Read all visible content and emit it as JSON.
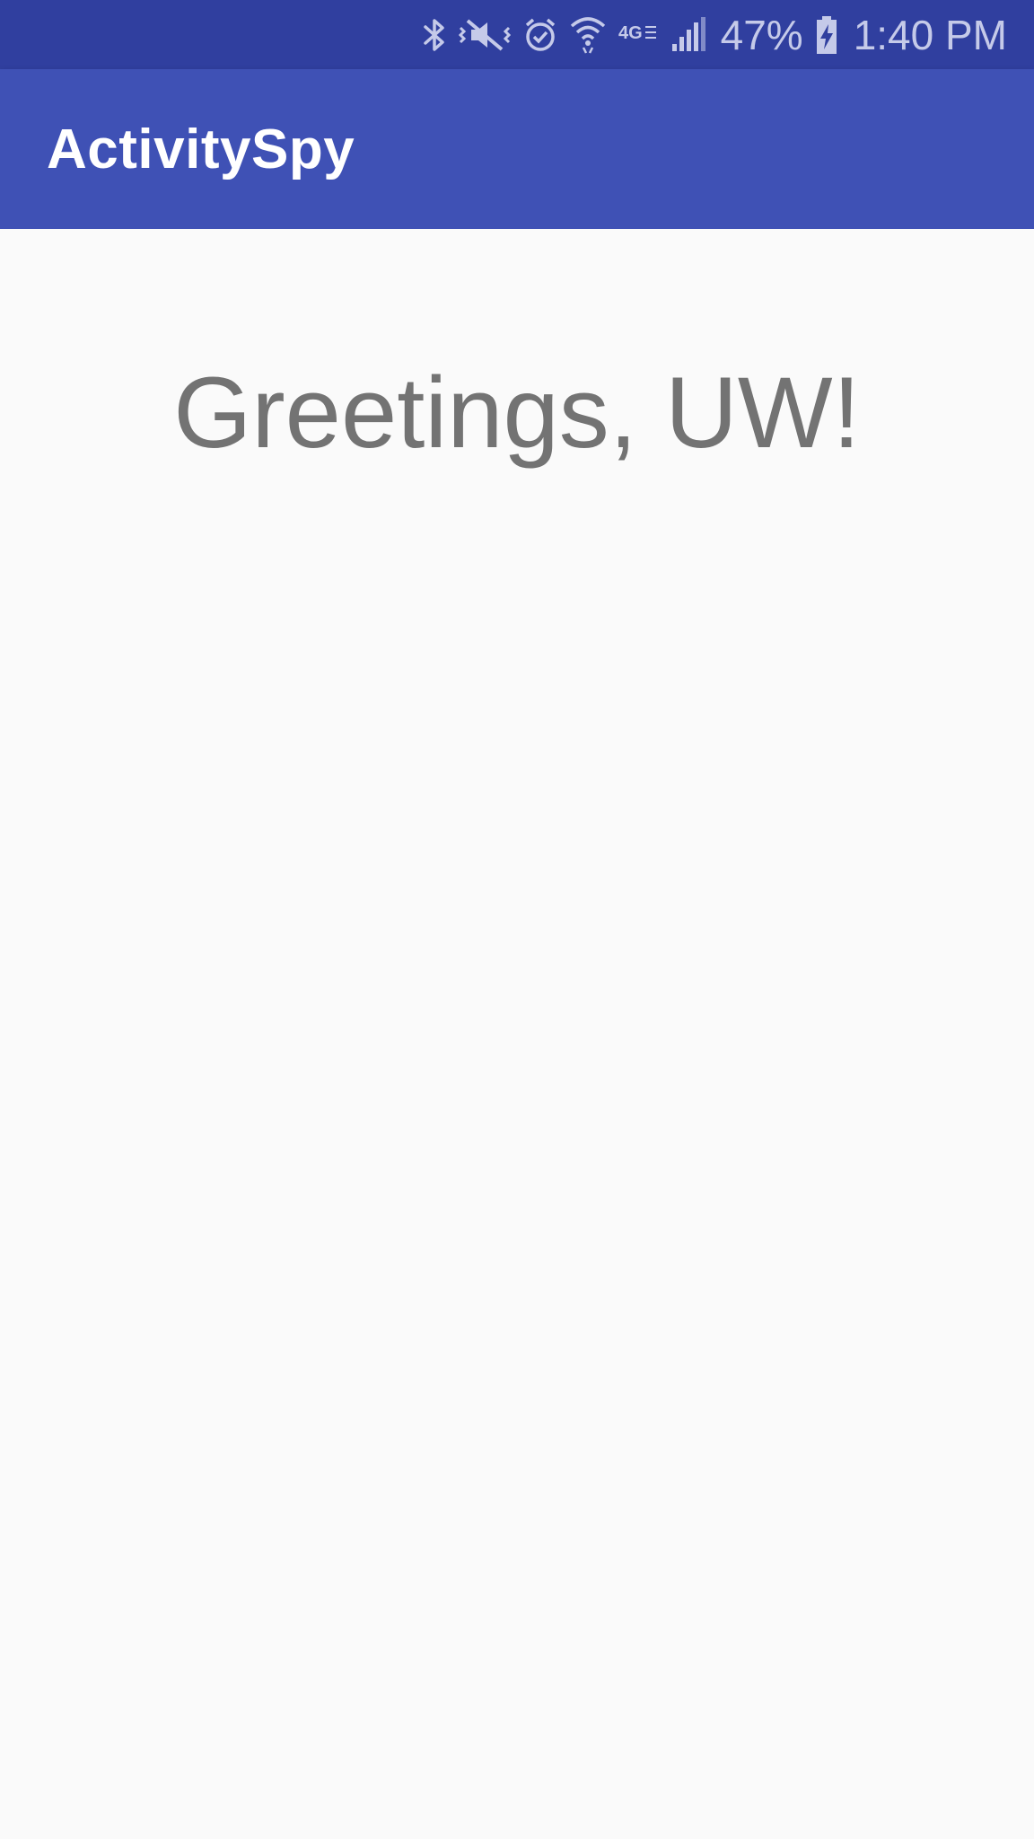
{
  "status_bar": {
    "icons": [
      "bluetooth-icon",
      "vibrate-mute-icon",
      "alarm-icon",
      "wifi-icon",
      "lte-icon",
      "signal-icon",
      "battery-charging-icon"
    ],
    "network_label": "4G",
    "battery_percent": "47%",
    "time": "1:40 PM",
    "background_color": "#303f9f",
    "icon_color": "#c5cae9"
  },
  "app_bar": {
    "title": "ActivitySpy",
    "background_color": "#3f51b5"
  },
  "main": {
    "greeting": "Greetings, UW!",
    "text_color": "#737373"
  }
}
